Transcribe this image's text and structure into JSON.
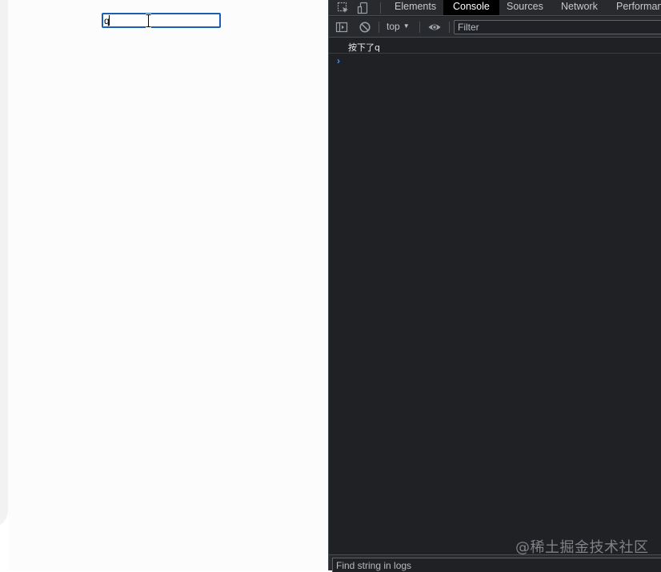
{
  "page": {
    "input_value": "q"
  },
  "devtools": {
    "tabs": [
      {
        "label": "Elements",
        "active": false
      },
      {
        "label": "Console",
        "active": true
      },
      {
        "label": "Sources",
        "active": false
      },
      {
        "label": "Network",
        "active": false
      },
      {
        "label": "Performan",
        "active": false
      }
    ],
    "toolbar": {
      "context": "top",
      "filter_placeholder": "Filter"
    },
    "console": {
      "logs": [
        "按下了q"
      ],
      "prompt": "›"
    },
    "find": {
      "placeholder": "Find string in logs"
    },
    "watermark": "@稀土掘金技术社区"
  },
  "colors": {
    "accent": "#1a5fb4",
    "devtools_bg": "#202124",
    "active_tab_bg": "#000000",
    "prompt": "#4d8df6"
  },
  "icons": {
    "inspect": "inspect-element-icon",
    "device": "device-toolbar-icon",
    "sidebar": "console-sidebar-icon",
    "clear": "clear-console-icon",
    "eye": "live-expression-icon",
    "cursor": "text-cursor-icon"
  }
}
